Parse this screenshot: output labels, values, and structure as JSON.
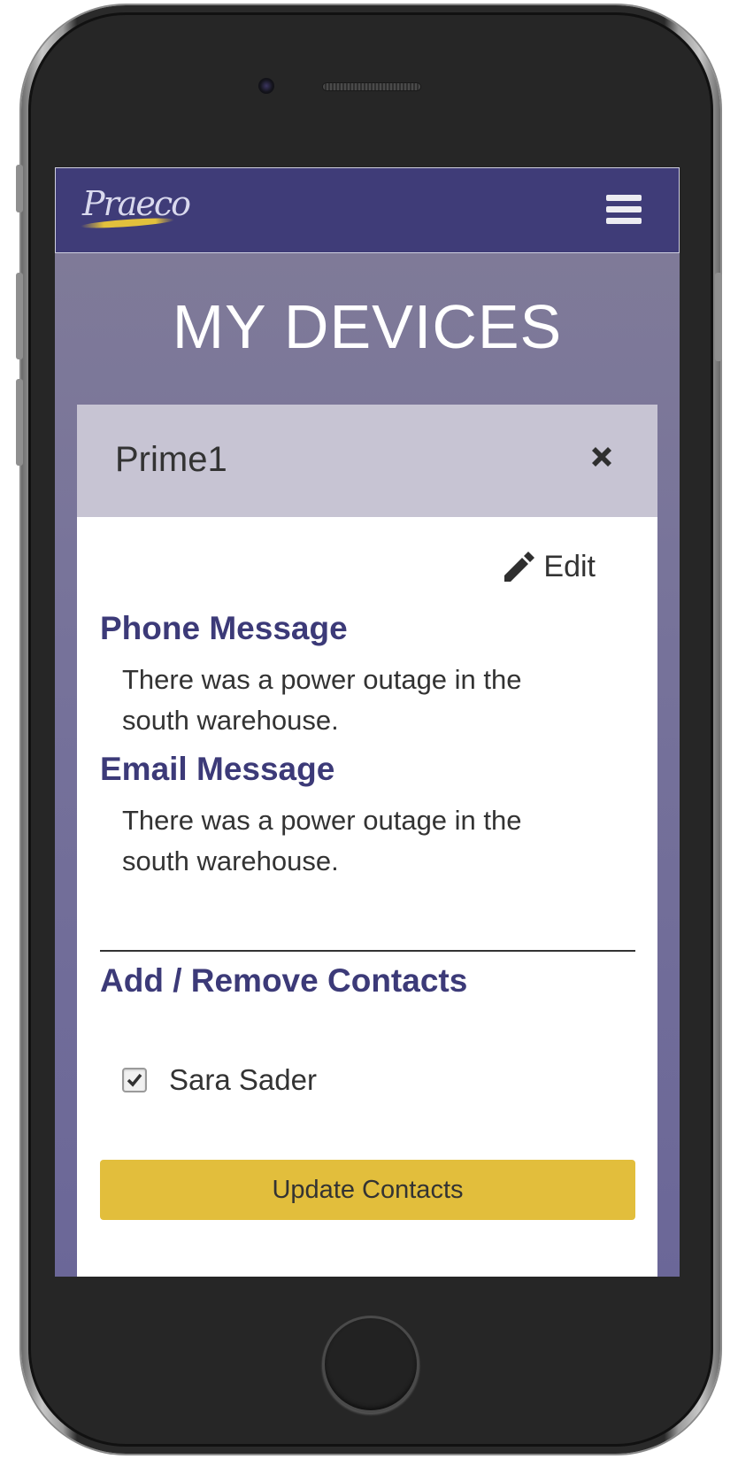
{
  "header": {
    "logo_text": "Praeco"
  },
  "page": {
    "title": "MY DEVICES"
  },
  "device": {
    "name": "Prime1",
    "edit_label": "Edit",
    "phone_message_heading": "Phone Message",
    "phone_message": "There was a power outage in the south warehouse.",
    "email_message_heading": "Email Message",
    "email_message": "There was a power outage in the south warehouse.",
    "contacts_heading": "Add / Remove Contacts",
    "contacts": [
      {
        "name": "Sara Sader",
        "checked": true
      }
    ],
    "update_button_label": "Update Contacts"
  },
  "colors": {
    "navbar": "#3f3c78",
    "heading": "#3c3a78",
    "button": "#e2be3c",
    "card_header": "#c7c4d3"
  },
  "icons": [
    "hamburger-menu-icon",
    "close-icon",
    "pencil-icon",
    "checkmark-icon"
  ]
}
